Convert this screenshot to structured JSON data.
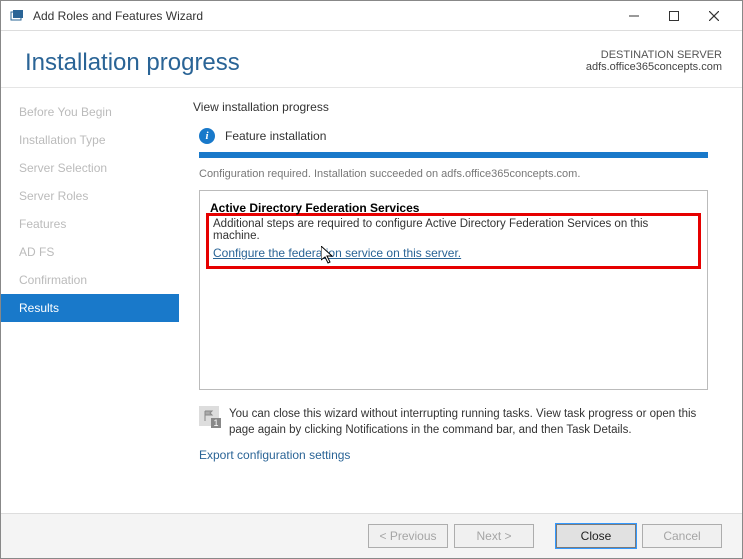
{
  "titlebar": {
    "title": "Add Roles and Features Wizard"
  },
  "header": {
    "title": "Installation progress",
    "destination_label": "DESTINATION SERVER",
    "destination_server": "adfs.office365concepts.com"
  },
  "sidebar": {
    "items": [
      {
        "label": "Before You Begin"
      },
      {
        "label": "Installation Type"
      },
      {
        "label": "Server Selection"
      },
      {
        "label": "Server Roles"
      },
      {
        "label": "Features"
      },
      {
        "label": "AD FS"
      },
      {
        "label": "Confirmation"
      },
      {
        "label": "Results",
        "active": true
      }
    ]
  },
  "main": {
    "subheading": "View installation progress",
    "feature_label": "Feature installation",
    "status_text": "Configuration required. Installation succeeded on adfs.office365concepts.com.",
    "panel": {
      "title": "Active Directory Federation Services",
      "desc": "Additional steps are required to configure Active Directory Federation Services on this machine.",
      "link": "Configure the federation service on this server."
    },
    "note": "You can close this wizard without interrupting running tasks. View task progress or open this page again by clicking Notifications in the command bar, and then Task Details.",
    "export_link": "Export configuration settings"
  },
  "footer": {
    "previous": "< Previous",
    "next": "Next >",
    "close": "Close",
    "cancel": "Cancel"
  }
}
